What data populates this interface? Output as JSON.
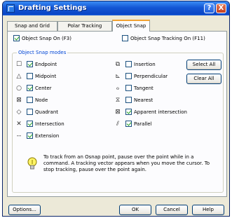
{
  "window": {
    "title": "Drafting Settings",
    "help_glyph": "?",
    "close_glyph": "X"
  },
  "tabs": [
    "Snap and Grid",
    "Polar Tracking",
    "Object Snap"
  ],
  "snap_on": {
    "label": "Object Snap On (F3)",
    "checked": true
  },
  "tracking_on": {
    "label": "Object Snap Tracking On (F11)",
    "checked": false
  },
  "modes_group_title": "Object Snap modes",
  "modes": [
    {
      "label": "Endpoint",
      "symbol": "☐",
      "checked": true
    },
    {
      "label": "Midpoint",
      "symbol": "△",
      "checked": false
    },
    {
      "label": "Center",
      "symbol": "○",
      "checked": true
    },
    {
      "label": "Node",
      "symbol": "⊠",
      "checked": false
    },
    {
      "label": "Quadrant",
      "symbol": "◇",
      "checked": false
    },
    {
      "label": "Intersection",
      "symbol": "✕",
      "checked": true
    },
    {
      "label": "Extension",
      "symbol": "--",
      "checked": true
    },
    {
      "label": "Insertion",
      "symbol": "⧉",
      "checked": false
    },
    {
      "label": "Perpendicular",
      "symbol": "⊾",
      "checked": false
    },
    {
      "label": "Tangent",
      "symbol": "ℴ",
      "checked": false
    },
    {
      "label": "Nearest",
      "symbol": "⧖",
      "checked": false
    },
    {
      "label": "Apparent intersection",
      "symbol": "⊠",
      "checked": true
    },
    {
      "label": "Parallel",
      "symbol": "⫽",
      "checked": true
    }
  ],
  "buttons": {
    "select_all": "Select All",
    "clear_all": "Clear All"
  },
  "info_text": "To track from an Osnap point, pause over the point while in a command. A tracking vector appears when you move the cursor. To stop tracking, pause over the point again.",
  "footer": {
    "options": "Options...",
    "ok": "OK",
    "cancel": "Cancel",
    "help": "Help"
  },
  "colors": {
    "titlebar": "#0a46c6",
    "group_title": "#0046d5",
    "check": "#21a121",
    "active_tab_accent": "#f1a131"
  }
}
